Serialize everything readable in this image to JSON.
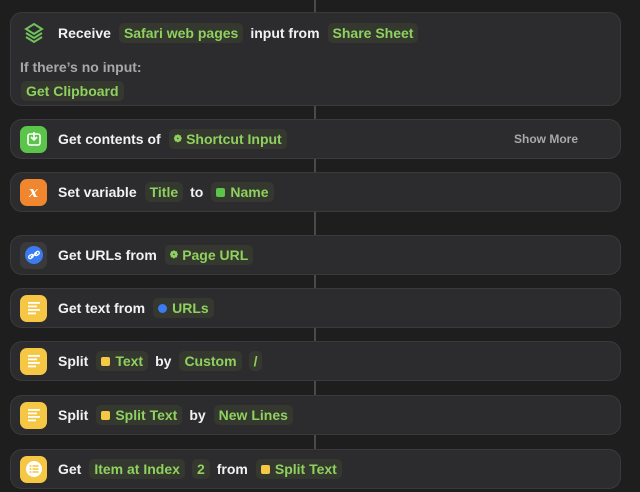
{
  "receive": {
    "verb": "Receive",
    "input_type": "Safari web pages",
    "middle": "input from",
    "source": "Share Sheet",
    "no_input_label": "If there’s no input:",
    "fallback": "Get Clipboard"
  },
  "get_contents": {
    "label": "Get contents of",
    "input": "Shortcut Input",
    "show_more": "Show More"
  },
  "set_variable": {
    "label": "Set variable",
    "name": "Title",
    "to": "to",
    "value": "Name"
  },
  "get_urls": {
    "label": "Get URLs from",
    "input": "Page URL"
  },
  "get_text": {
    "label": "Get text from",
    "input": "URLs"
  },
  "split1": {
    "label": "Split",
    "input": "Text",
    "by": "by",
    "separator": "Custom",
    "custom": "/"
  },
  "split2": {
    "label": "Split",
    "input": "Split Text",
    "by": "by",
    "separator": "New Lines"
  },
  "get_item": {
    "label": "Get",
    "item": "Item at Index",
    "index": "2",
    "from": "from",
    "input": "Split Text"
  },
  "colors": {
    "token_text": "#8fd15f",
    "token_bg": "#34382f",
    "card_bg": "#2c2c2e",
    "green_icon": "#5ac44b",
    "orange_icon": "#f0862e",
    "yellow_icon": "#f6c745",
    "blue_dot": "#3a7bf2"
  }
}
